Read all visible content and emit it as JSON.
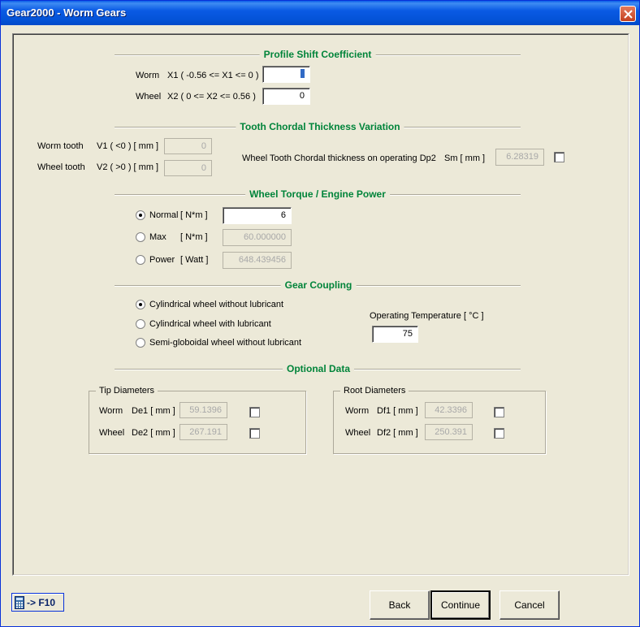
{
  "window": {
    "title": "Gear2000 - Worm Gears"
  },
  "profile_shift": {
    "title": "Profile Shift Coefficient",
    "worm_label": "Worm",
    "worm_range": "X1 ( -0.56 <= X1 <= 0 )",
    "worm_value": "0",
    "wheel_label": "Wheel",
    "wheel_range": "X2 ( 0 <= X2 <= 0.56 )",
    "wheel_value": "0"
  },
  "chordal": {
    "title": "Tooth Chordal Thickness Variation",
    "worm_tooth_label": "Worm tooth",
    "v1_label": "V1 ( <0 ) [ mm ]",
    "v1_value": "0",
    "wheel_tooth_label": "Wheel tooth",
    "v2_label": "V2 ( >0 ) [ mm ]",
    "v2_value": "0",
    "sm_desc": "Wheel Tooth Chordal thickness on operating Dp2",
    "sm_label": "Sm [ mm ]",
    "sm_value": "6.28319"
  },
  "torque": {
    "title": "Wheel Torque / Engine Power",
    "normal_label": "Normal",
    "normal_unit": "[ N*m ]",
    "normal_value": "6",
    "max_label": "Max",
    "max_unit": "[ N*m ]",
    "max_value": "60.000000",
    "power_label": "Power",
    "power_unit": "[ Watt ]",
    "power_value": "648.439456",
    "selected": "Normal"
  },
  "coupling": {
    "title": "Gear Coupling",
    "options": [
      "Cylindrical wheel without lubricant",
      "Cylindrical wheel with lubricant",
      "Semi-globoidal wheel without lubricant"
    ],
    "selected": "Cylindrical wheel without lubricant",
    "temp_label": "Operating Temperature [ °C ]",
    "temp_value": "75"
  },
  "optional": {
    "title": "Optional Data",
    "tip": {
      "title": "Tip Diameters",
      "worm_label": "Worm",
      "de1_label": "De1 [ mm ]",
      "de1_value": "59.1396",
      "wheel_label": "Wheel",
      "de2_label": "De2 [ mm ]",
      "de2_value": "267.191"
    },
    "root": {
      "title": "Root Diameters",
      "worm_label": "Worm",
      "df1_label": "Df1 [ mm ]",
      "df1_value": "42.3396",
      "wheel_label": "Wheel",
      "df2_label": "Df2 [ mm ]",
      "df2_value": "250.391"
    }
  },
  "footer": {
    "calc_label": "-> F10",
    "back_label": "Back",
    "continue_label": "Continue",
    "cancel_label": "Cancel"
  },
  "colors": {
    "section_title": "#00843a",
    "titlebar": "#0a5ae4",
    "background": "#ece9d8"
  }
}
